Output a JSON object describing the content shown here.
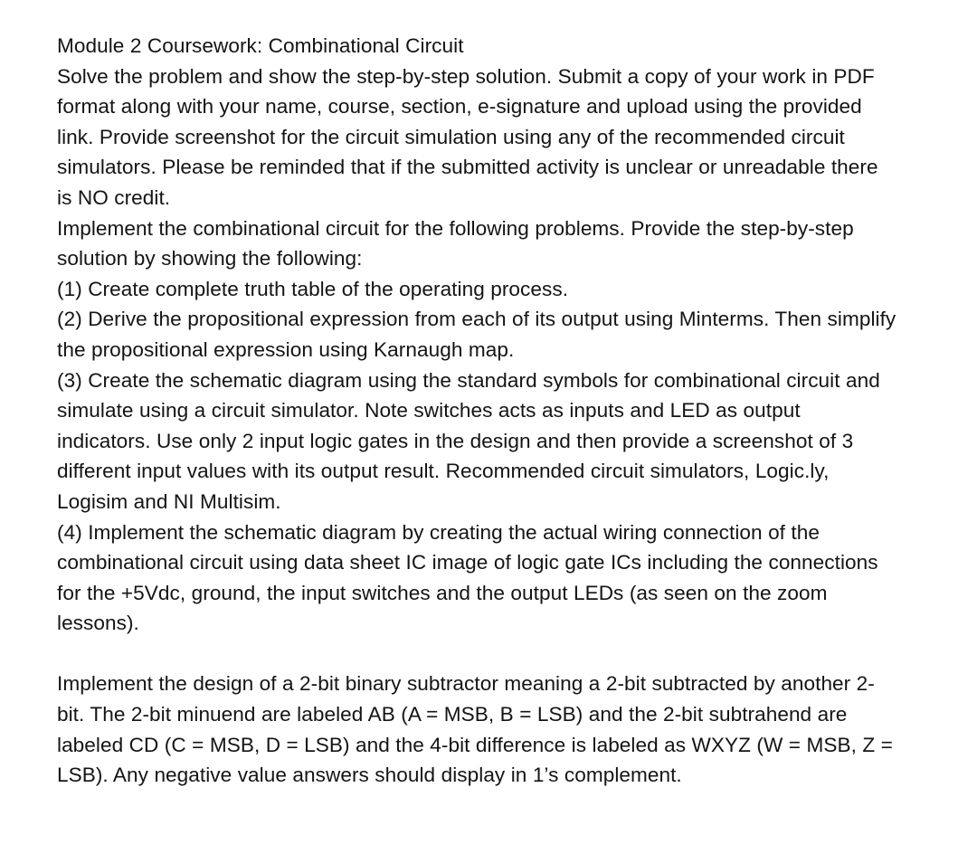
{
  "document": {
    "title_line": "Module 2 Coursework: Combinational Circuit",
    "background_color": "#ffffff",
    "text_color": "#141414",
    "paragraphs": [
      {
        "id": "intro-and-instructions",
        "text": "Module 2 Coursework: Combinational Circuit\nSolve the problem and show the step-by-step solution. Submit a copy of your work in PDF format along with your name, course, section, e-signature and upload using the provided link. Provide screenshot for the circuit simulation using any of the recommended circuit simulators. Please be reminded that if the submitted activity is unclear or unreadable there is NO credit.\nImplement the combinational circuit for the following problems. Provide the step-by-step solution by showing the following:\n(1) Create complete truth table of the operating process.\n(2) Derive the propositional expression from each of its output using Minterms. Then simplify the propositional expression using Karnaugh map.\n(3) Create the schematic diagram using the standard symbols for combinational circuit and simulate using a circuit simulator. Note switches acts as inputs and LED as output indicators. Use only 2 input logic gates in the design and then provide a screenshot of 3 different input values with its output result. Recommended circuit simulators, Logic.ly, Logisim and NI Multisim.\n(4) Implement the schematic diagram by creating the actual wiring connection of the combinational circuit using data sheet IC image of logic gate ICs including the connections for the +5Vdc, ground, the input switches and the output LEDs (as seen on the zoom lessons)."
      },
      {
        "id": "problem-statement",
        "text": "Implement the design of a 2-bit binary subtractor meaning a 2-bit subtracted by another 2-bit. The 2-bit minuend are labeled AB (A = MSB, B = LSB) and the 2-bit subtrahend are labeled CD (C = MSB, D = LSB) and the 4-bit difference is labeled as WXYZ (W = MSB, Z = LSB). Any negative value answers should display in 1’s complement."
      }
    ]
  }
}
